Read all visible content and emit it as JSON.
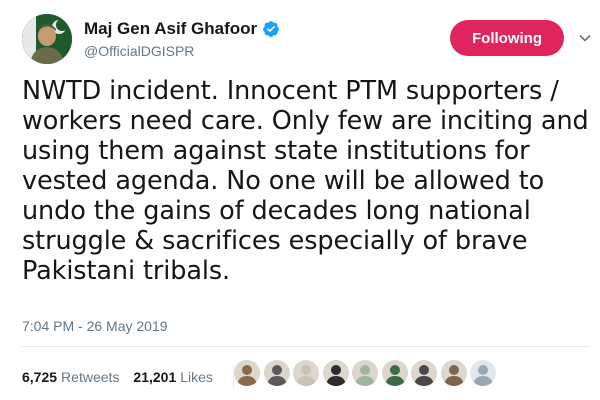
{
  "user": {
    "name": "Maj Gen Asif Ghafoor",
    "handle": "@OfficialDGISPR",
    "verified": true
  },
  "follow_button": {
    "label": "Following",
    "color": "#e0245e"
  },
  "tweet": {
    "lines": [
      "NWTD incident. Innocent PTM supporters /",
      "workers need care. Only few are inciting and",
      "using them against state institutions for",
      "vested agenda. No one will be allowed to",
      "undo the gains of decades long national",
      "struggle & sacrifices especially of brave",
      "Pakistani tribals."
    ]
  },
  "timestamp": "7:04 PM - 26 May 2019",
  "stats": {
    "retweets": {
      "count": "6,725",
      "label": "Retweets"
    },
    "likes": {
      "count": "21,201",
      "label": "Likes"
    }
  },
  "likers": [
    {
      "icon": "liker-avatar-1",
      "color": "#8a6a4a"
    },
    {
      "icon": "liker-avatar-2",
      "color": "#5a5a5a"
    },
    {
      "icon": "liker-avatar-3",
      "color": "#c9c2b6"
    },
    {
      "icon": "liker-avatar-4",
      "color": "#2c2c2c"
    },
    {
      "icon": "liker-avatar-5",
      "color": "#a1b4a0"
    },
    {
      "icon": "liker-avatar-6",
      "color": "#3d6b4a"
    },
    {
      "icon": "liker-avatar-7",
      "color": "#4a4a4a"
    },
    {
      "icon": "liker-avatar-8",
      "color": "#7a6650"
    },
    {
      "icon": "liker-avatar-9",
      "color": "#9aa6b0"
    }
  ]
}
